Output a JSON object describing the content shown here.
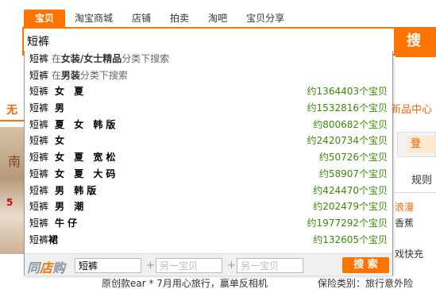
{
  "tabs": [
    {
      "label": "宝贝",
      "active": true
    },
    {
      "label": "淘宝商城",
      "active": false
    },
    {
      "label": "店铺",
      "active": false
    },
    {
      "label": "拍卖",
      "active": false
    },
    {
      "label": "淘吧",
      "active": false
    },
    {
      "label": "宝贝分享",
      "active": false
    }
  ],
  "search": {
    "value": "短裤",
    "button_label": "搜"
  },
  "suggestions": [
    {
      "kw": "短裤",
      "extra": "",
      "cat_pre": "在",
      "cat": "女装/女士精品",
      "cat_post": "分类下搜索",
      "count": ""
    },
    {
      "kw": "短裤",
      "extra": "",
      "cat_pre": "在",
      "cat": "男装",
      "cat_post": "分类下搜索",
      "count": ""
    },
    {
      "kw": "短裤",
      "extra": "女 夏",
      "cat_pre": "",
      "cat": "",
      "cat_post": "",
      "count": "约1364403个宝贝"
    },
    {
      "kw": "短裤",
      "extra": "男",
      "cat_pre": "",
      "cat": "",
      "cat_post": "",
      "count": "约1532816个宝贝"
    },
    {
      "kw": "短裤",
      "extra": "夏 女 韩版",
      "cat_pre": "",
      "cat": "",
      "cat_post": "",
      "count": "约800682个宝贝"
    },
    {
      "kw": "短裤",
      "extra": "女",
      "cat_pre": "",
      "cat": "",
      "cat_post": "",
      "count": "约2420734个宝贝"
    },
    {
      "kw": "短裤",
      "extra": "女 夏 宽松",
      "cat_pre": "",
      "cat": "",
      "cat_post": "",
      "count": "约50726个宝贝"
    },
    {
      "kw": "短裤",
      "extra": "女 夏 大码",
      "cat_pre": "",
      "cat": "",
      "cat_post": "",
      "count": "约58907个宝贝"
    },
    {
      "kw": "短裤",
      "extra": "男 韩版",
      "cat_pre": "",
      "cat": "",
      "cat_post": "",
      "count": "约424470个宝贝"
    },
    {
      "kw": "短裤",
      "extra": "男 潮",
      "cat_pre": "",
      "cat": "",
      "cat_post": "",
      "count": "约202479个宝贝"
    },
    {
      "kw": "短裤",
      "extra": "牛仔",
      "cat_pre": "",
      "cat": "",
      "cat_post": "",
      "count": "约1977292个宝贝"
    },
    {
      "kw": "短裤",
      "extra": "裙",
      "cat_pre": "",
      "cat": "",
      "cat_post": "",
      "count": "约132605个宝贝"
    }
  ],
  "compare": {
    "brand_a": "同",
    "brand_b": "店",
    "brand_c": "购",
    "input1_value": "短裤",
    "input2_placeholder": "另一宝贝",
    "input3_placeholder": "另一宝贝",
    "plus": "+",
    "search_label": "搜 索"
  },
  "background": {
    "left_red": "无",
    "xinpin": "新品中心",
    "login": "登",
    "guize": "规则",
    "langman": "浪漫",
    "xiangjiao": "香蕉",
    "kuaiyuan": "戏快充",
    "img_text1": "南",
    "img_text2": "5",
    "bottom_left": "原创款ear  * 7月用心旅行，赢单反相机",
    "bottom_right": "保险类别：旅行意外险"
  },
  "colors": {
    "accent": "#ff7300",
    "count_green": "#3a8a00"
  }
}
